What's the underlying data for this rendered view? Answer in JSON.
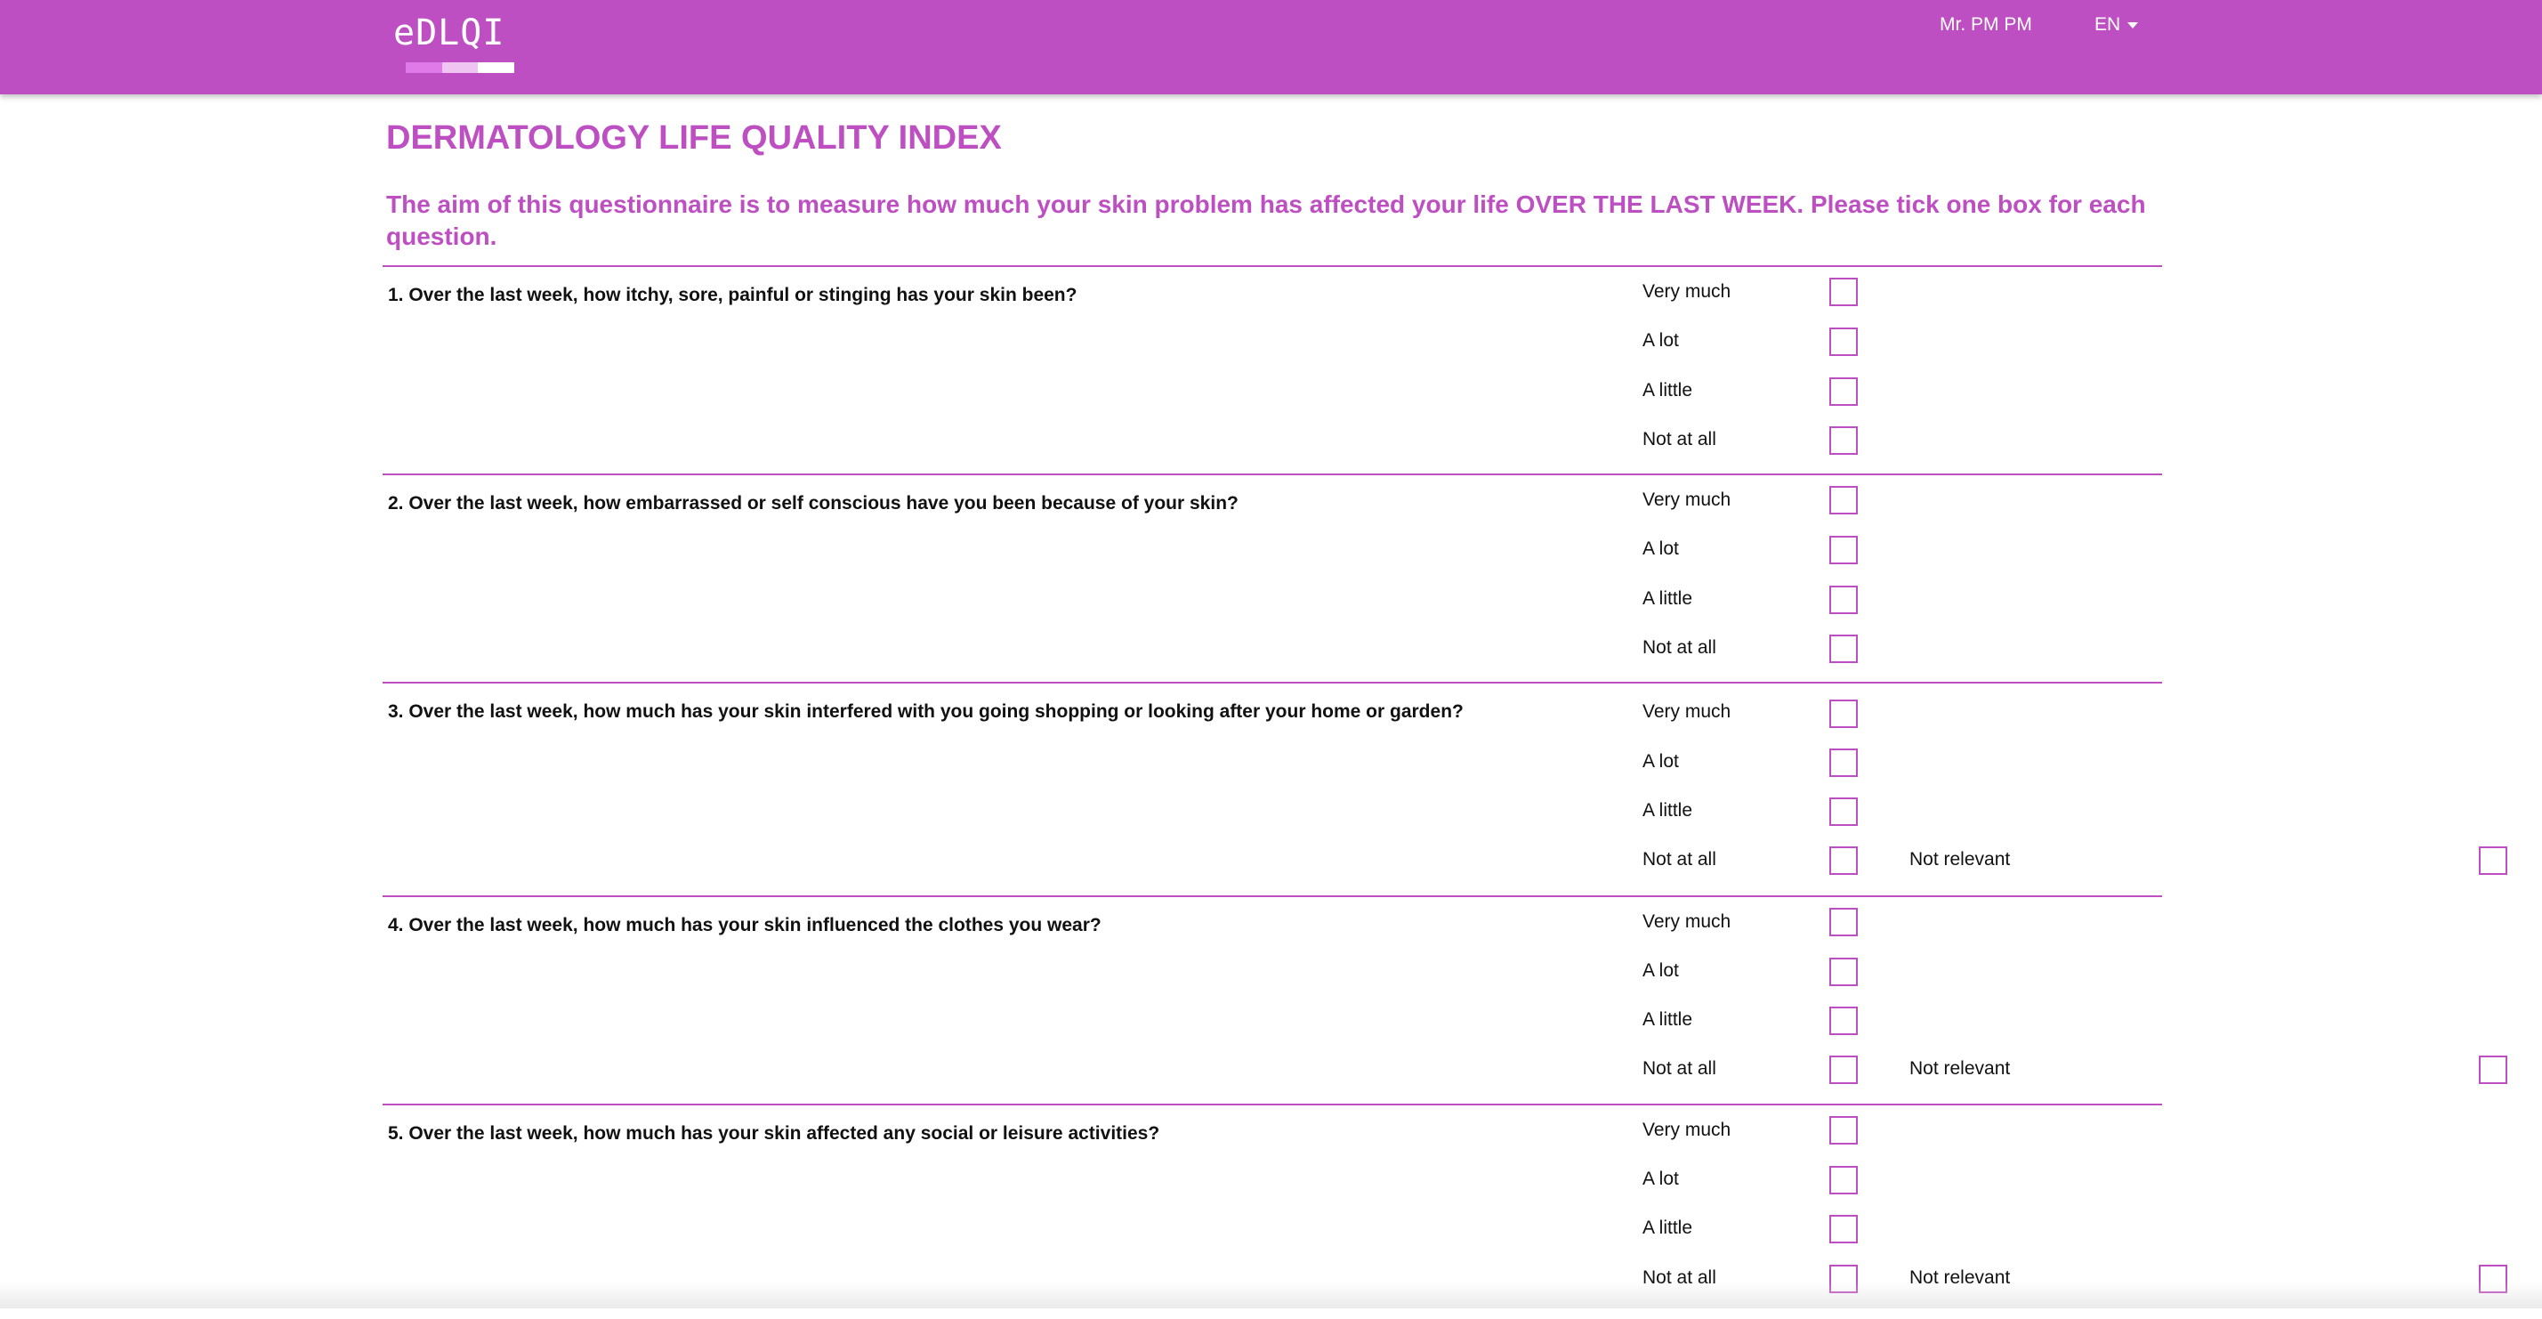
{
  "header": {
    "logo": "eDLQI",
    "logo_bar_colors": [
      "#e07ae8",
      "#f0c4f2",
      "#ffffff"
    ],
    "user": "Mr. PM PM",
    "language": "EN"
  },
  "page": {
    "title": "DERMATOLOGY LIFE QUALITY INDEX",
    "intro": "The aim of this questionnaire is to measure how much your skin problem has affected your life OVER THE LAST WEEK. Please tick one box for each question."
  },
  "options": [
    "Very much",
    "A lot",
    "A little",
    "Not at all"
  ],
  "not_relevant_label": "Not relevant",
  "questions": [
    {
      "text": "1. Over the last week, how itchy, sore, painful or stinging has your skin been?",
      "not_relevant": false
    },
    {
      "text": "2. Over the last week, how embarrassed or self conscious have you been because of your skin?",
      "not_relevant": false
    },
    {
      "text": "3. Over the last week, how much has your skin interfered with you going shopping or looking after your home or garden?",
      "not_relevant": true
    },
    {
      "text": "4. Over the last week, how much has your skin influenced the clothes you wear?",
      "not_relevant": true
    },
    {
      "text": "5. Over the last week, how much has your skin affected any social or leisure activities?",
      "not_relevant": true
    }
  ],
  "colors": {
    "accent": "#bd4fc2"
  }
}
